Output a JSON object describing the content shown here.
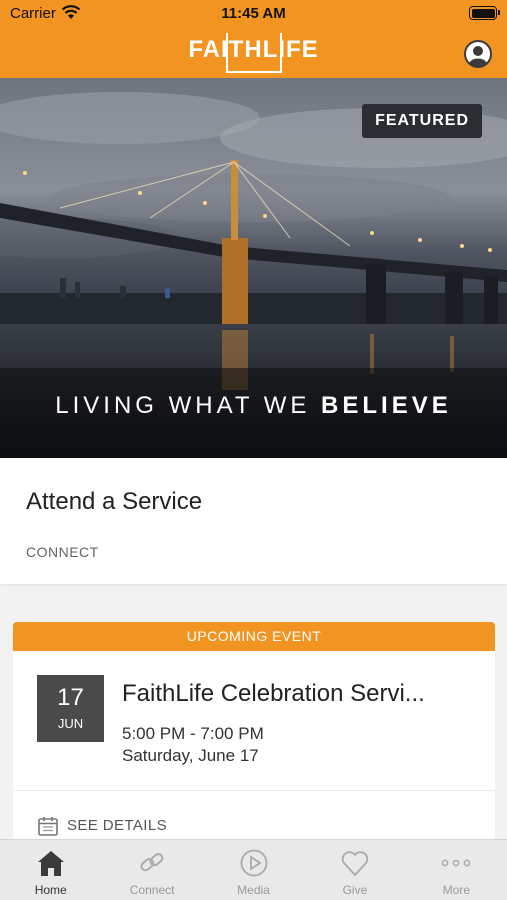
{
  "status": {
    "carrier": "Carrier",
    "time": "11:45 AM"
  },
  "header": {
    "logo": "FAITHLIFE"
  },
  "hero": {
    "badge": "FEATURED",
    "title_regular": "LIVING WHAT WE ",
    "title_bold": "BELIEVE"
  },
  "attend": {
    "title": "Attend a Service",
    "category": "CONNECT"
  },
  "event": {
    "banner": "UPCOMING EVENT",
    "day": "17",
    "month": "JUN",
    "name": "FaithLife Celebration Servi...",
    "time": "5:00 PM - 7:00 PM",
    "date": "Saturday, June 17",
    "details": "SEE DETAILS"
  },
  "tabs": [
    {
      "label": "Home",
      "icon": "home-icon",
      "active": true
    },
    {
      "label": "Connect",
      "icon": "link-icon",
      "active": false
    },
    {
      "label": "Media",
      "icon": "play-icon",
      "active": false
    },
    {
      "label": "Give",
      "icon": "heart-icon",
      "active": false
    },
    {
      "label": "More",
      "icon": "more-icon",
      "active": false
    }
  ],
  "colors": {
    "brand": "#f29422",
    "badge": "#2a2d31",
    "date_block": "#4a4a4a"
  }
}
